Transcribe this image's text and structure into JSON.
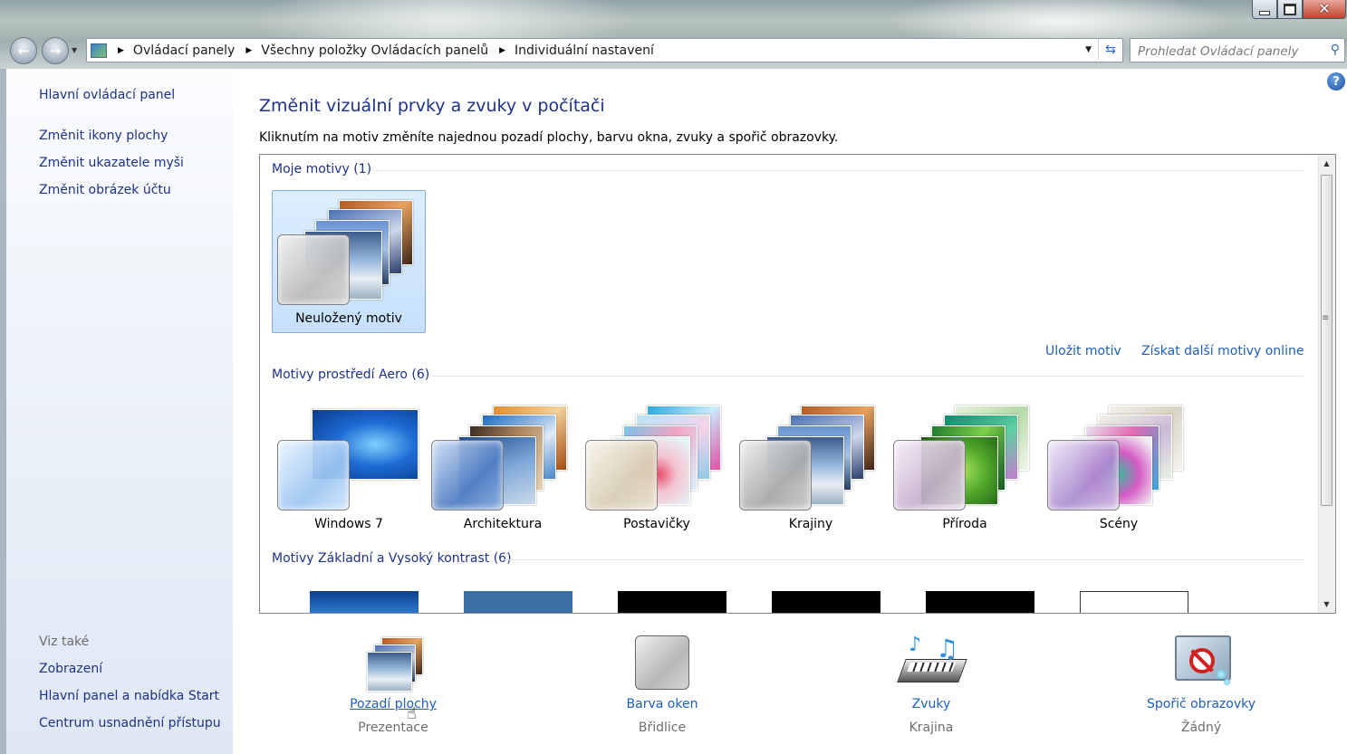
{
  "window": {
    "minimize_glyph": "",
    "close_glyph": "✕"
  },
  "nav": {
    "back_glyph": "←",
    "forward_glyph": "→"
  },
  "address": {
    "breadcrumbs": [
      "Ovládací panely",
      "Všechny položky Ovládacích panelů",
      "Individuální nastavení"
    ],
    "icon": "control-panel-icon",
    "refresh_icon": "refresh-icon"
  },
  "search": {
    "placeholder": "Prohledat Ovládací panely",
    "icon": "search-icon"
  },
  "sidebar": {
    "home": "Hlavní ovládací panel",
    "links": [
      "Změnit ikony plochy",
      "Změnit ukazatele myši",
      "Změnit obrázek účtu"
    ],
    "see_also_heading": "Viz také",
    "see_also": [
      "Zobrazení",
      "Hlavní panel a nabídka Start",
      "Centrum usnadnění přístupu"
    ]
  },
  "main": {
    "title": "Změnit vizuální prvky a zvuky v počítači",
    "description": "Kliknutím na motiv změníte najednou pozadí plochy, barvu okna, zvuky a spořič obrazovky.",
    "help_icon": "help-icon",
    "help_glyph": "?"
  },
  "themes": {
    "my_group": "Moje motivy (1)",
    "my_items": [
      "Neuložený motiv"
    ],
    "save_link": "Uložit motiv",
    "more_link": "Získat další motivy online",
    "aero_group": "Motivy prostředí Aero (6)",
    "aero_items": [
      "Windows 7",
      "Architektura",
      "Postavičky",
      "Krajiny",
      "Příroda",
      "Scény"
    ],
    "basic_group": "Motivy Základní a Vysoký kontrast (6)"
  },
  "bottom": [
    {
      "label": "Pozadí plochy",
      "sub": "Prezentace",
      "icon": "desktop-background-icon"
    },
    {
      "label": "Barva oken",
      "sub": "Břidlice",
      "icon": "window-color-icon"
    },
    {
      "label": "Zvuky",
      "sub": "Krajina",
      "icon": "sounds-icon"
    },
    {
      "label": "Spořič obrazovky",
      "sub": "Žádný",
      "icon": "screensaver-icon"
    }
  ],
  "colors": {
    "link": "#1e3287",
    "action_link": "#1e5fb8",
    "selected_bg": "#c6e0fc",
    "basic_swatches": [
      "#0c4fa8",
      "#3a6ea5",
      "#000000",
      "#000000",
      "#000000",
      "#ffffff"
    ]
  }
}
